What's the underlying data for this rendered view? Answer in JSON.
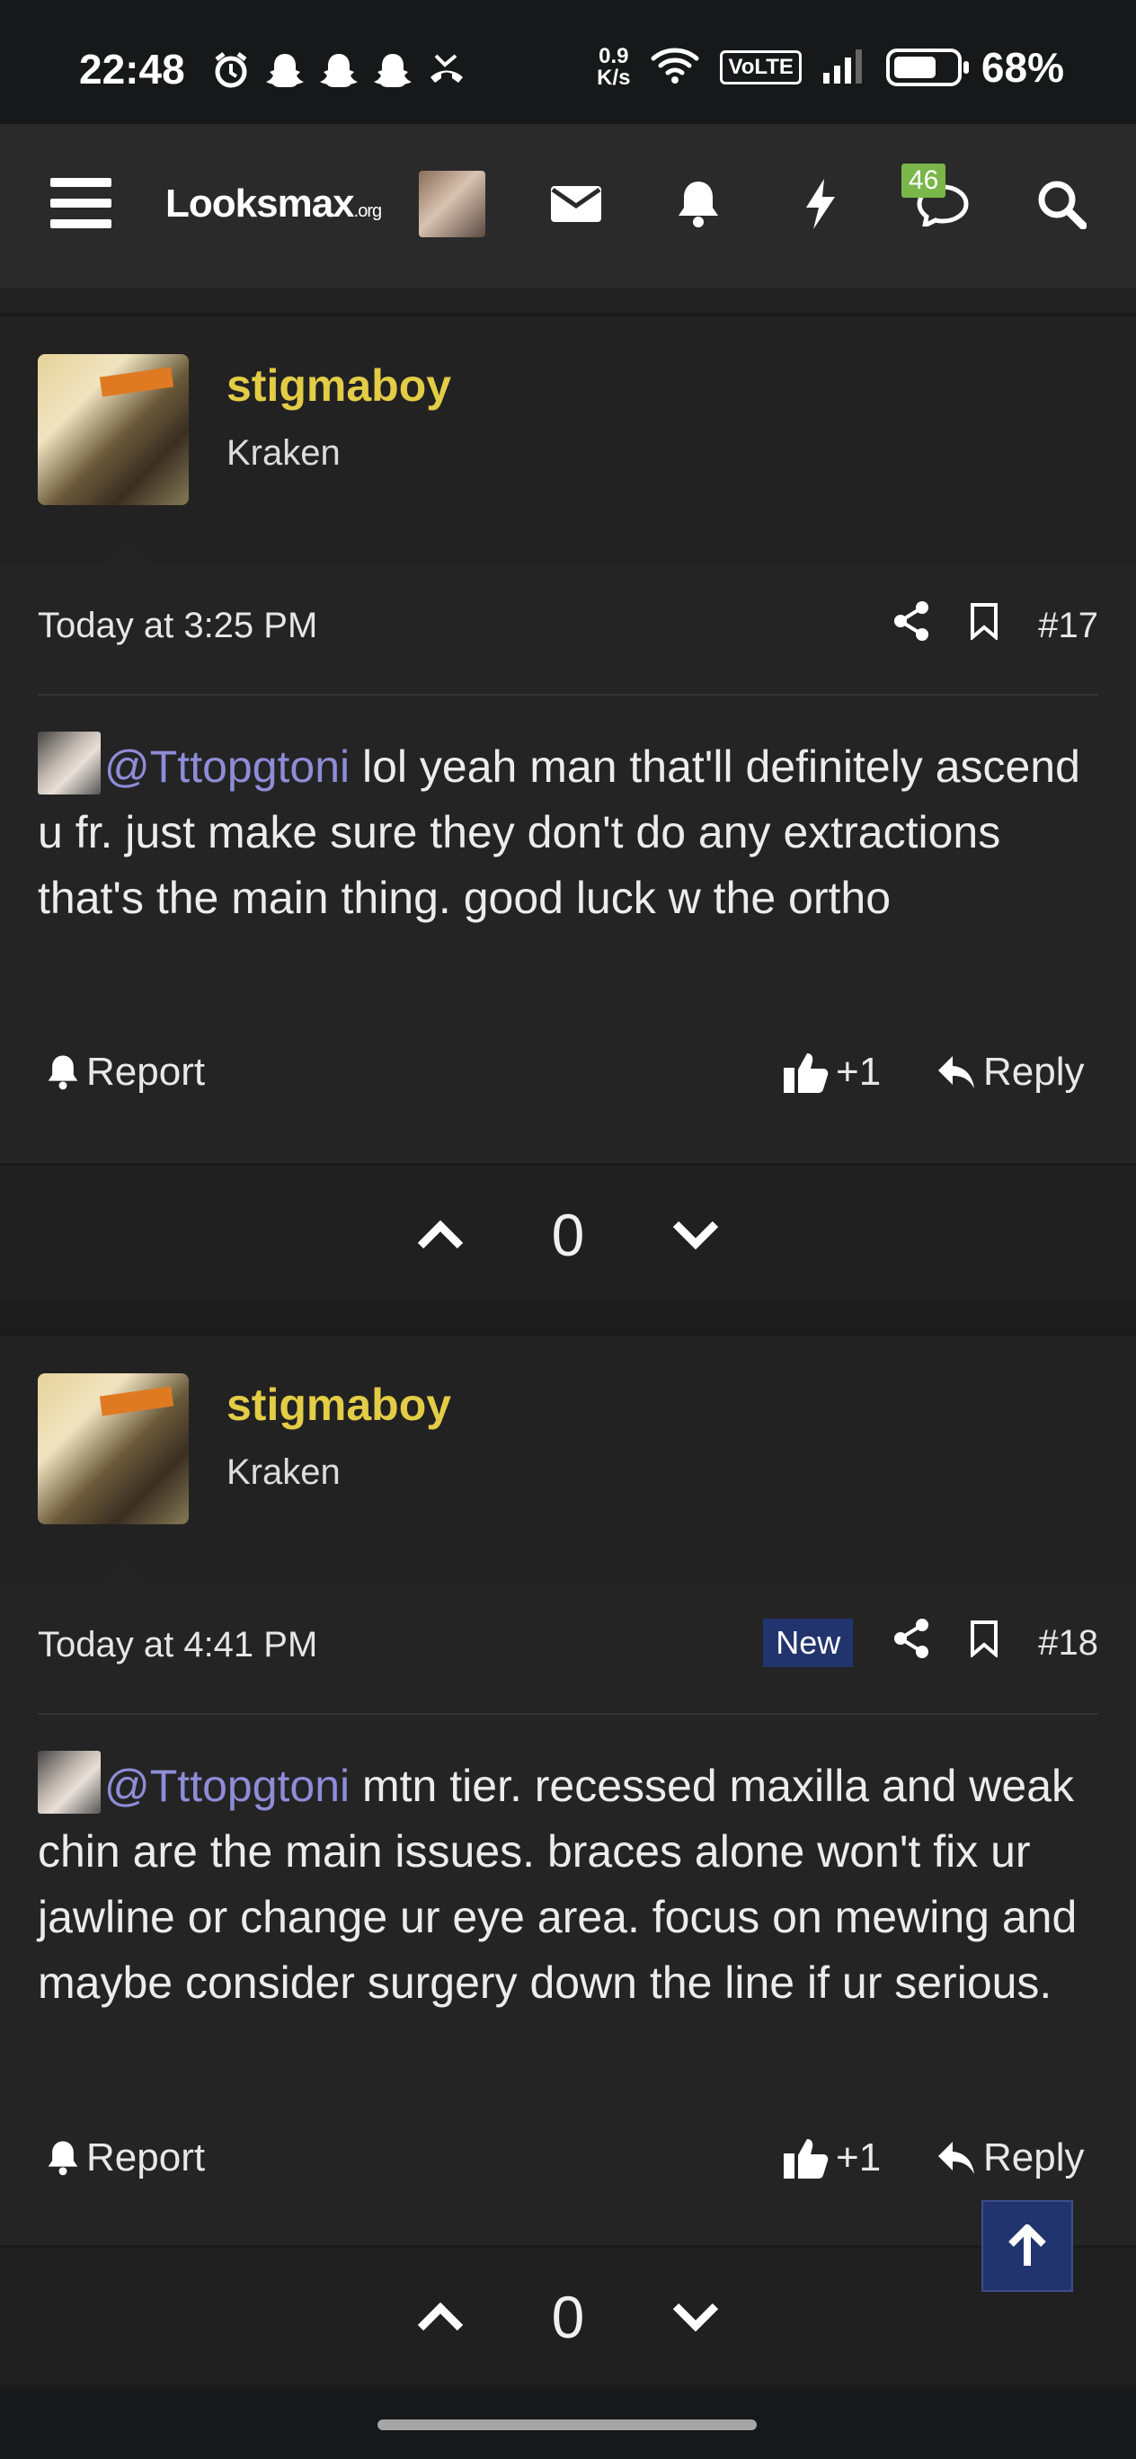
{
  "status_bar": {
    "time": "22:48",
    "net_speed_top": "0.9",
    "net_speed_bottom": "K/s",
    "volte": "VoLTE",
    "battery": "68%",
    "battery_level": 0.68
  },
  "header": {
    "logo_main": "Looksmax",
    "logo_suffix": ".org",
    "conversations_badge": "46",
    "icons": [
      "menu-icon",
      "envelope-icon",
      "bell-icon",
      "bolt-icon",
      "chat-icon",
      "search-icon"
    ]
  },
  "posts": [
    {
      "username": "stigmaboy",
      "role": "Kraken",
      "time": "Today at 3:25 PM",
      "new_label": "",
      "number": "#17",
      "mention": "@Tttopgtoni",
      "text": " lol yeah man that'll definitely ascend u fr. just make sure they don't do any extractions that's the main thing. good luck w the ortho",
      "report_label": "Report",
      "like_label": "+1",
      "reply_label": "Reply",
      "score": "0"
    },
    {
      "username": "stigmaboy",
      "role": "Kraken",
      "time": "Today at 4:41 PM",
      "new_label": "New",
      "number": "#18",
      "mention": "@Tttopgtoni",
      "text": " mtn tier. recessed maxilla and weak chin are the main issues. braces alone won't fix ur jawline or change ur eye area. focus on mewing and maybe consider surgery down the line if ur serious.",
      "report_label": "Report",
      "like_label": "+1",
      "reply_label": "Reply",
      "score": "0"
    }
  ],
  "colors": {
    "username": "#e3cc46",
    "mention": "#8f8cd8",
    "accent_badge": "#22346e",
    "alerts_badge": "#7ab648"
  }
}
